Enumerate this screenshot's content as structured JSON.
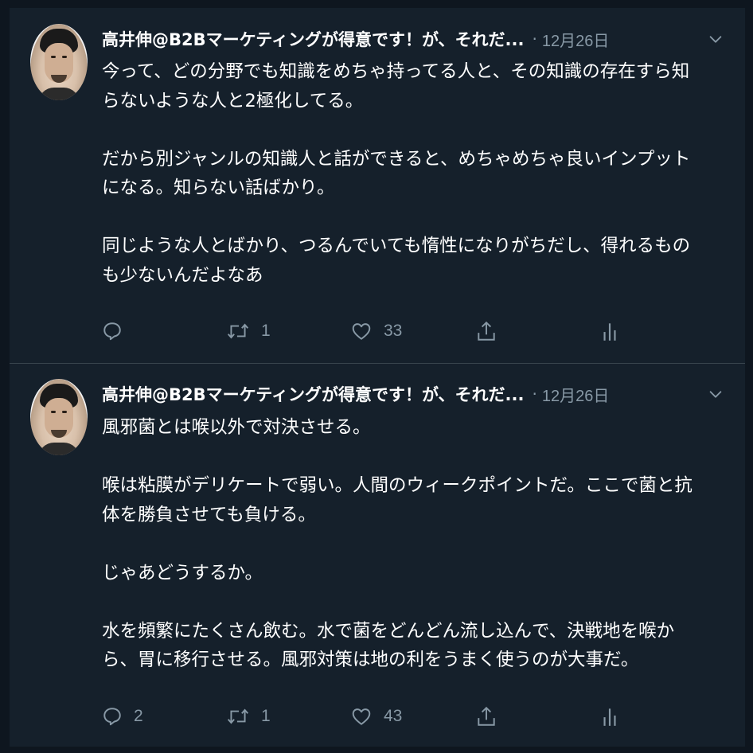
{
  "tweets": [
    {
      "author": "高井伸@B2Bマーケティングが得意です！が、それだ...",
      "separator": "·",
      "date": "12月26日",
      "text": "今って、どの分野でも知識をめちゃ持ってる人と、その知識の存在すら知\nらないような人と2極化してる。\n\nだから別ジャンルの知識人と話ができると、めちゃめちゃ良いインプット\nになる。知らない話ばかり。\n\n同じような人とばかり、つるんでいても惰性になりがちだし、得れるもの\nも少ないんだよなあ",
      "actions": {
        "reply_count": "",
        "retweet_count": "1",
        "like_count": "33"
      }
    },
    {
      "author": "高井伸@B2Bマーケティングが得意です！が、それだ...",
      "separator": "·",
      "date": "12月26日",
      "text": "風邪菌とは喉以外で対決させる。\n\n喉は粘膜がデリケートで弱い。人間のウィークポイントだ。ここで菌と抗\n体を勝負させても負ける。\n\nじゃあどうするか。\n\n水を頻繁にたくさん飲む。水で菌をどんどん流し込んで、決戦地を喉か\nら、胃に移行させる。風邪対策は地の利をうまく使うのが大事だ。",
      "actions": {
        "reply_count": "2",
        "retweet_count": "1",
        "like_count": "43"
      }
    }
  ],
  "icons": {
    "reply": "reply-icon",
    "retweet": "retweet-icon",
    "like": "heart-icon",
    "share": "share-icon",
    "analytics": "analytics-icon",
    "caret": "chevron-down-icon"
  },
  "colors": {
    "background": "#15202b",
    "text": "#ffffff",
    "muted": "#8899a6",
    "divider": "#38444d"
  }
}
